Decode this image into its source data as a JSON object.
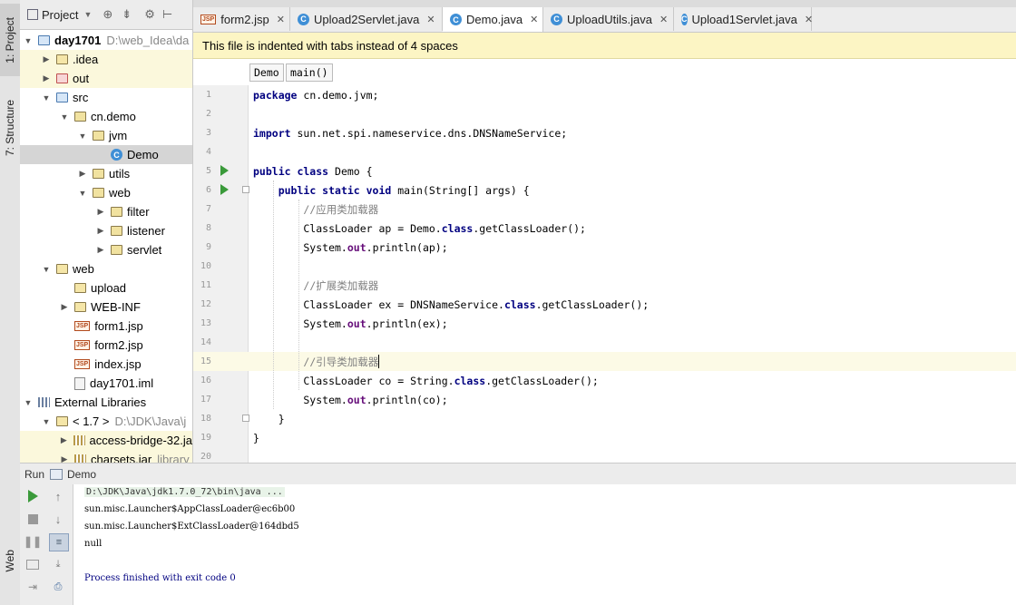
{
  "left_strip": {
    "project_tab": "1: Project",
    "structure_tab": "7: Structure",
    "web_tab": "Web"
  },
  "project_pane": {
    "header_label": "Project",
    "tree": [
      {
        "label": "day1701",
        "extra": "D:\\web_Idea\\da",
        "icon": "module-folder-icon",
        "bold": true
      },
      {
        "label": ".idea",
        "icon": "folder-icon"
      },
      {
        "label": "out",
        "icon": "excluded-folder-icon"
      },
      {
        "label": "src",
        "icon": "source-folder-icon"
      },
      {
        "label": "cn.demo",
        "icon": "package-icon"
      },
      {
        "label": "jvm",
        "icon": "package-icon"
      },
      {
        "label": "Demo",
        "icon": "java-class-icon"
      },
      {
        "label": "utils",
        "icon": "package-icon"
      },
      {
        "label": "web",
        "icon": "package-icon"
      },
      {
        "label": "filter",
        "icon": "package-icon"
      },
      {
        "label": "listener",
        "icon": "package-icon"
      },
      {
        "label": "servlet",
        "icon": "package-icon"
      },
      {
        "label": "web",
        "icon": "web-folder-icon"
      },
      {
        "label": "upload",
        "icon": "folder-icon"
      },
      {
        "label": "WEB-INF",
        "icon": "folder-icon"
      },
      {
        "label": "form1.jsp",
        "icon": "jsp-file-icon"
      },
      {
        "label": "form2.jsp",
        "icon": "jsp-file-icon"
      },
      {
        "label": "index.jsp",
        "icon": "jsp-file-icon"
      },
      {
        "label": "day1701.iml",
        "icon": "iml-file-icon"
      },
      {
        "label": "External Libraries",
        "icon": "libraries-icon"
      },
      {
        "label": "< 1.7 >",
        "extra": "D:\\JDK\\Java\\j",
        "icon": "jdk-folder-icon"
      },
      {
        "label": "access-bridge-32.ja",
        "icon": "jar-icon"
      },
      {
        "label": "charsets.jar",
        "extra": "library",
        "icon": "jar-icon"
      }
    ]
  },
  "tabs": [
    {
      "label": "form2.jsp",
      "icon": "jsp-file-icon"
    },
    {
      "label": "Upload2Servlet.java",
      "icon": "java-class-icon"
    },
    {
      "label": "Demo.java",
      "icon": "java-class-icon",
      "active": true
    },
    {
      "label": "UploadUtils.java",
      "icon": "java-class-icon"
    },
    {
      "label": "Upload1Servlet.java",
      "icon": "java-class-icon"
    }
  ],
  "banner": {
    "text": "This file is indented with tabs instead of 4 spaces"
  },
  "breadcrumbs": [
    "Demo",
    "main()"
  ],
  "editor": {
    "line_numbers": [
      "1",
      "2",
      "3",
      "4",
      "5",
      "6",
      "7",
      "8",
      "9",
      "10",
      "11",
      "12",
      "13",
      "14",
      "15",
      "16",
      "17",
      "18",
      "19",
      "20"
    ],
    "lines": [
      [
        {
          "t": "package",
          "c": "kw"
        },
        {
          "t": " cn.demo.jvm;"
        }
      ],
      [],
      [
        {
          "t": "import",
          "c": "kw"
        },
        {
          "t": " sun.net.spi.nameservice.dns.DNSNameService;"
        }
      ],
      [],
      [
        {
          "t": "public class",
          "c": "kw"
        },
        {
          "t": " Demo {"
        }
      ],
      [
        {
          "t": "    "
        },
        {
          "t": "public static void",
          "c": "kw"
        },
        {
          "t": " main(String[] args) {"
        }
      ],
      [
        {
          "t": "        "
        },
        {
          "t": "//应用类加载器",
          "c": "cm"
        }
      ],
      [
        {
          "t": "        ClassLoader ap = Demo."
        },
        {
          "t": "class",
          "c": "kw"
        },
        {
          "t": ".getClassLoader();"
        }
      ],
      [
        {
          "t": "        System."
        },
        {
          "t": "out",
          "c": "fld"
        },
        {
          "t": ".println(ap);"
        }
      ],
      [],
      [
        {
          "t": "        "
        },
        {
          "t": "//扩展类加载器",
          "c": "cm"
        }
      ],
      [
        {
          "t": "        ClassLoader ex = DNSNameService."
        },
        {
          "t": "class",
          "c": "kw"
        },
        {
          "t": ".getClassLoader();"
        }
      ],
      [
        {
          "t": "        System."
        },
        {
          "t": "out",
          "c": "fld"
        },
        {
          "t": ".println(ex);"
        }
      ],
      [],
      [
        {
          "t": "        "
        },
        {
          "t": "//引导类加载器",
          "c": "cm"
        }
      ],
      [
        {
          "t": "        ClassLoader co = String."
        },
        {
          "t": "class",
          "c": "kw"
        },
        {
          "t": ".getClassLoader();"
        }
      ],
      [
        {
          "t": "        System."
        },
        {
          "t": "out",
          "c": "fld"
        },
        {
          "t": ".println(co);"
        }
      ],
      [
        {
          "t": "    }"
        }
      ],
      [
        {
          "t": "}"
        }
      ],
      []
    ]
  },
  "run_panel": {
    "header_label": "Run",
    "config_name": "Demo",
    "console": [
      {
        "text": "D:\\JDK\\Java\\jdk1.7.0_72\\bin\\java ...",
        "kind": "cmd"
      },
      {
        "text": "sun.misc.Launcher$AppClassLoader@ec6b00",
        "kind": "out"
      },
      {
        "text": "sun.misc.Launcher$ExtClassLoader@164dbd5",
        "kind": "out"
      },
      {
        "text": "null",
        "kind": "out"
      },
      {
        "text": "",
        "kind": "out"
      },
      {
        "text": "Process finished with exit code 0",
        "kind": "exit"
      }
    ]
  },
  "colors": {
    "keyword": "#000080",
    "comment": "#808080",
    "run_green": "#3a9a3a",
    "banner": "#fcf5c4"
  }
}
